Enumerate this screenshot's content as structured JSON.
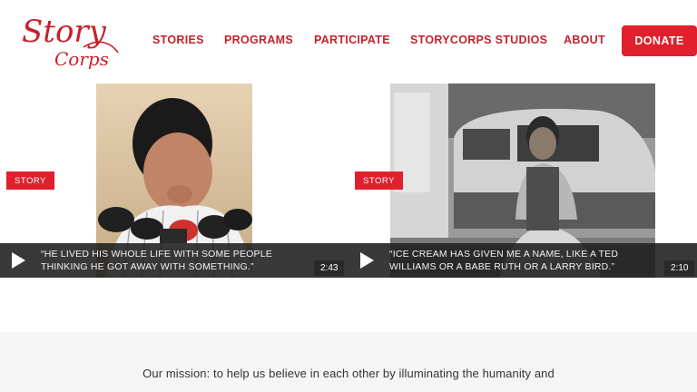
{
  "brand": {
    "logo_text_line1": "Story",
    "logo_text_line2": "Corps",
    "color": "#c8202c"
  },
  "nav": {
    "items": [
      {
        "label": "STORIES"
      },
      {
        "label": "PROGRAMS"
      },
      {
        "label": "PARTICIPATE"
      },
      {
        "label": "STORYCORPS STUDIOS"
      },
      {
        "label": "ABOUT"
      }
    ],
    "donate_label": "DONATE"
  },
  "cards": [
    {
      "badge": "STORY",
      "quote": "“HE LIVED HIS WHOLE LIFE WITH SOME PEOPLE THINKING HE GOT AWAY WITH SOMETHING.”",
      "duration": "2:43"
    },
    {
      "badge": "STORY",
      "quote": "“ICE CREAM HAS GIVEN ME A NAME, LIKE A TED WILLIAMS OR A BABE RUTH OR A LARRY BIRD.”",
      "duration": "2:10"
    }
  ],
  "mission": {
    "text": "Our mission: to help us believe in each other by illuminating the humanity and"
  },
  "colors": {
    "accent": "#e0202c",
    "nav_text": "#c8202c",
    "band": "#f5f5f5"
  }
}
